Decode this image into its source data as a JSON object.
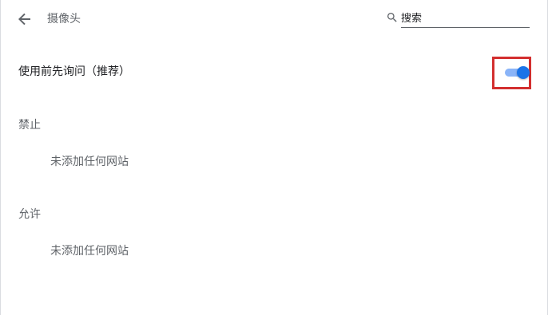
{
  "header": {
    "title": "摄像头",
    "back_icon": "arrow-left-icon"
  },
  "search": {
    "placeholder": "搜索",
    "value": "",
    "icon": "search-icon"
  },
  "ask_before_access": {
    "label": "使用前先询问（推荐）",
    "enabled": true
  },
  "sections": {
    "blocked": {
      "header": "禁止",
      "empty_text": "未添加任何网站"
    },
    "allowed": {
      "header": "允许",
      "empty_text": "未添加任何网站"
    }
  },
  "colors": {
    "accent": "#1a73e8",
    "toggle_track": "#8ab4f8",
    "highlight": "#d32f2f"
  }
}
